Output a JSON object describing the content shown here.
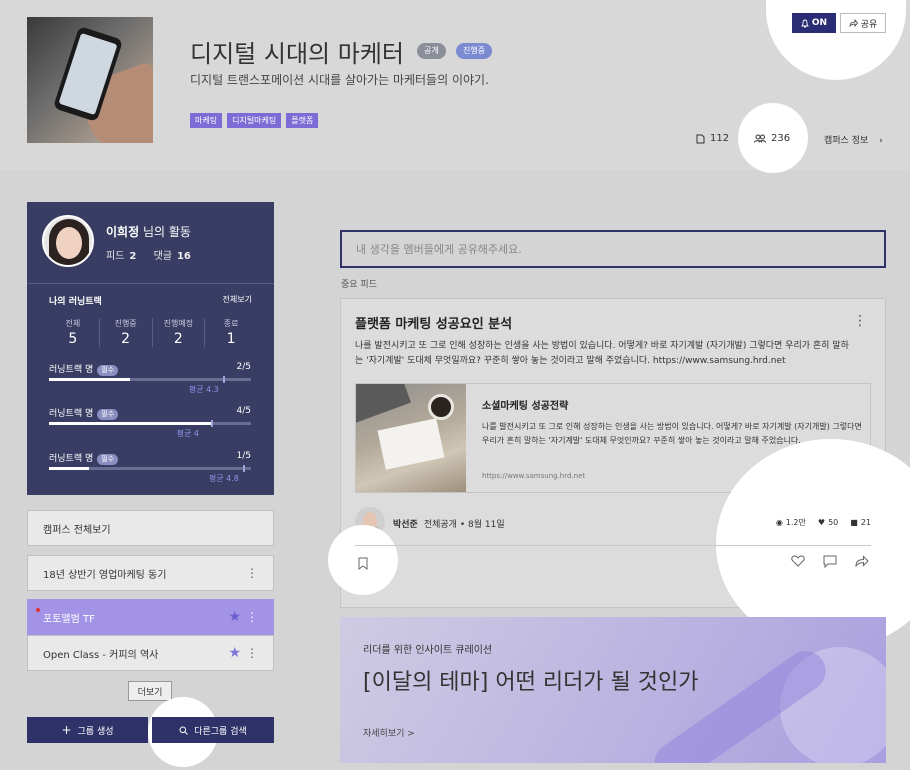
{
  "header": {
    "title": "디지털 시대의 마케터",
    "badges": [
      "공개",
      "진행중"
    ],
    "subtitle": "디지털 트랜스포메이션 시대를 살아가는 마케터들의 이야기.",
    "tags": [
      "마케팅",
      "디지털마케팅",
      "플랫폼"
    ],
    "post_count": "112",
    "member_count": "236",
    "campus_info": "캠퍼스 정보",
    "notify_label": "ON",
    "share_label": "공유"
  },
  "profile": {
    "name": "이희정",
    "name_suffix": " 님의 활동",
    "feed_label": "피드",
    "feed_count": "2",
    "comment_label": "댓글",
    "comment_count": "16",
    "learning_track_title": "나의 러닝트랙",
    "view_all": "전체보기",
    "counts": [
      {
        "label": "전체",
        "value": "5"
      },
      {
        "label": "진행중",
        "value": "2"
      },
      {
        "label": "진행예정",
        "value": "2"
      },
      {
        "label": "종료",
        "value": "1"
      }
    ],
    "tracks": [
      {
        "name": "러닝트랙 명",
        "pill": "필수",
        "fraction": "2/5",
        "progress": 0.4,
        "avg_label": "평균 4.3",
        "avg": 0.86
      },
      {
        "name": "러닝트랙 명",
        "pill": "필수",
        "fraction": "4/5",
        "progress": 0.8,
        "avg_label": "평균 4",
        "avg": 0.8
      },
      {
        "name": "러닝트랙 명",
        "pill": "필수",
        "fraction": "1/5",
        "progress": 0.2,
        "avg_label": "평균 4.8",
        "avg": 0.96
      }
    ]
  },
  "sidebar": {
    "items": [
      {
        "label": "캠퍼스 전체보기"
      },
      {
        "label": "18년 상반기 영업마케팅 동기"
      },
      {
        "label": "포토앨범 TF"
      },
      {
        "label": "Open Class - 커피의 역사"
      }
    ],
    "more_label": "더보기",
    "create_group": "그룹 생성",
    "search_group": "다른그룹 검색"
  },
  "feed": {
    "input_placeholder": "내 생각을 멤버들에게 공유해주세요.",
    "section_label": "중요 피드",
    "post": {
      "title": "플랫폼 마케팅 성공요인 분석",
      "body": "나를 발전시키고 또 그로 인해 성장하는 인생을 사는 방법이 있습니다. 어떻게? 바로 자기계발 (자기개발) 그렇다면 우리가 흔히 말하는 '자기계발' 도대체 무엇일까요? 꾸준히 쌓아 놓는 것이라고 말해 주었습니다. https://www.samsung.hrd.net",
      "link_title": "소셜마케팅 성공전략",
      "link_desc": "나를 발전시키고 또 그로 인해 성장하는 인생을 사는 방법이 있습니다. 어떻게? 바로 자기계발 (자기개발) 그렇다면 우리가 흔히 말하는 '자기계발' 도대체 무엇인까요? 꾸준히 쌓아 놓는 것이라고 말해 주었습니다.",
      "link_url": "https://www.samsung.hrd.net",
      "author": "박선준",
      "meta": "전체공개 • 8월 11일",
      "views": "1.2만",
      "likes": "50",
      "comments": "21"
    }
  },
  "banner": {
    "subtitle": "리더를 위한 인사이트 큐레이션",
    "title": "[이달의 테마] 어떤 리더가 될 것인가",
    "link": "자세히보기 >"
  },
  "colors": {
    "accent": "#2f3269",
    "tag": "#7d6bd6",
    "active_group": "#a393e6"
  }
}
